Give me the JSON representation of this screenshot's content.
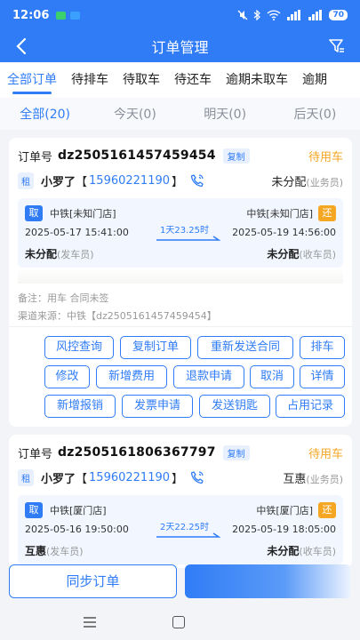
{
  "status_bar": {
    "time": "12:06",
    "battery": "70"
  },
  "header": {
    "title": "订单管理"
  },
  "tabs": [
    "全部订单",
    "待排车",
    "待取车",
    "待还车",
    "逾期未取车",
    "逾期"
  ],
  "day_tabs": [
    "全部(20)",
    "今天(0)",
    "明天(0)",
    "后天(0)"
  ],
  "orders": [
    {
      "order_no_label": "订单号",
      "order_no": "dz2505161457459454",
      "copy_label": "复制",
      "status": "待用车",
      "type_tag": "租",
      "customer": "小罗了",
      "phone": "15960221190",
      "salesperson": "未分配",
      "salesperson_sub": "(业务员)",
      "pickup_tag": "取",
      "return_tag": "还",
      "pickup_store": "中铁[未知门店]",
      "return_store": "中铁[未知门店]",
      "pickup_time": "2025-05-17 15:41:00",
      "return_time": "2025-05-19 14:56:00",
      "duration": "1天23.25时",
      "sender": "未分配",
      "sender_sub": "(发车员)",
      "receiver": "未分配",
      "receiver_sub": "(收车员)",
      "remark": "备注：用车 合同未签",
      "channel": "渠道来源：中铁【dz2505161457459454】",
      "actions": [
        "风控查询",
        "复制订单",
        "重新发送合同",
        "排车",
        "修改",
        "新增费用",
        "退款申请",
        "取消",
        "详情",
        "新增报销",
        "发票申请",
        "发送钥匙",
        "占用记录"
      ]
    },
    {
      "order_no_label": "订单号",
      "order_no": "dz2505161806367797",
      "copy_label": "复制",
      "status": "待用车",
      "type_tag": "租",
      "customer": "小罗了",
      "phone": "15960221190",
      "salesperson": "互惠",
      "salesperson_sub": "(业务员)",
      "pickup_tag": "取",
      "return_tag": "还",
      "pickup_store": "中铁[厦门店]",
      "return_store": "中铁[厦门店]",
      "pickup_time": "2025-05-16 19:50:00",
      "return_time": "2025-05-19 18:05:00",
      "duration": "2天22.25时",
      "sender": "互惠",
      "sender_sub": "(发车员)",
      "receiver": "未分配",
      "receiver_sub": "(收车员)"
    }
  ],
  "bottom": {
    "sync_label": "同步订单"
  },
  "colors": {
    "primary": "#2f7cf6",
    "pending": "#f5a623"
  }
}
